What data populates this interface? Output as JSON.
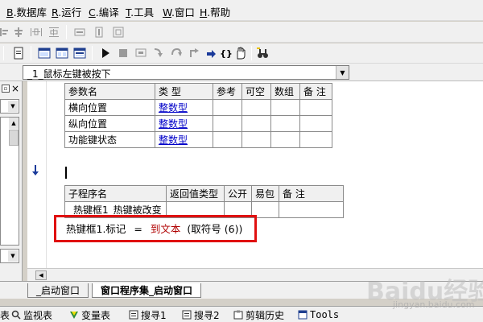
{
  "menu": [
    {
      "key": "B",
      "label": ".数据库"
    },
    {
      "key": "R",
      "label": ".运行"
    },
    {
      "key": "C",
      "label": ".编译"
    },
    {
      "key": "T",
      "label": ".工具"
    },
    {
      "key": "W",
      "label": ".窗口"
    },
    {
      "key": "H",
      "label": ".帮助"
    }
  ],
  "combo": {
    "value": "_1_鼠标左键被按下"
  },
  "params_table": {
    "headers": [
      "参数名",
      "类 型",
      "参考",
      "可空",
      "数组",
      "备 注"
    ],
    "rows": [
      {
        "name": "横向位置",
        "type": "整数型"
      },
      {
        "name": "纵向位置",
        "type": "整数型"
      },
      {
        "name": "功能键状态",
        "type": "整数型"
      }
    ]
  },
  "sub_table": {
    "headers": [
      "子程序名",
      "返回值类型",
      "公开",
      "易包",
      "备 注"
    ],
    "row": {
      "name": "_热键框1_热键被改变"
    }
  },
  "code": {
    "target": "热键框1.标记",
    "op": "=",
    "func": "到文本",
    "arg": "(取符号 (6))"
  },
  "tabs": [
    "_启动窗口",
    "窗口程序集_启动窗口"
  ],
  "bottom_panels": [
    {
      "label": "表",
      "icon": "table-icon"
    },
    {
      "label": "监视表",
      "icon": "magnifier-icon"
    },
    {
      "label": "变量表",
      "icon": "variable-icon"
    },
    {
      "label": "搜寻1",
      "icon": "search-icon"
    },
    {
      "label": "搜寻2",
      "icon": "search-icon"
    },
    {
      "label": "剪辑历史",
      "icon": "clipboard-icon"
    },
    {
      "label": "Tools",
      "icon": "tools-icon"
    }
  ],
  "watermark": {
    "text": "Baidu经验",
    "sub": "jingyan.baidu.com"
  },
  "colors": {
    "link": "#0000c8",
    "highlight_box": "#e01010",
    "function": "#b00000",
    "arrow": "#1a3a9a"
  }
}
